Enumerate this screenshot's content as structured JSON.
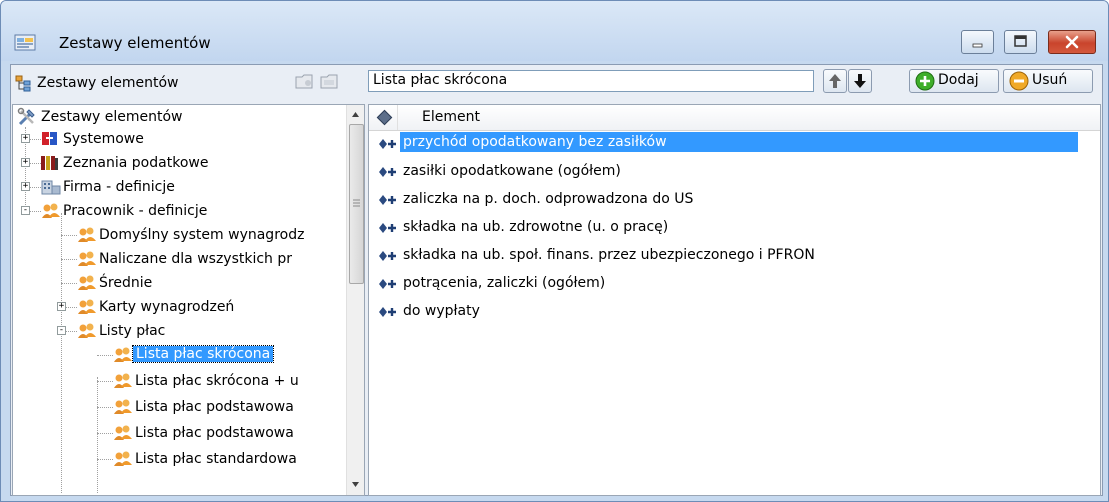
{
  "window": {
    "title": "Zestawy elementów",
    "controls": [
      "minimize",
      "maximize",
      "close"
    ]
  },
  "tree_toolbar": {
    "label": "Zestawy elementów",
    "buttons": [
      "new-folder-icon",
      "folder-icon"
    ]
  },
  "current_set": {
    "value": "Lista płac skrócona"
  },
  "actions": {
    "up_icon": "arrow-up-icon",
    "down_icon": "arrow-down-icon",
    "add_label": "Dodaj",
    "remove_label": "Usuń"
  },
  "tree": {
    "root": "Zestawy elementów",
    "items": [
      {
        "label": "Systemowe",
        "icon": "system-icon",
        "expander": "+"
      },
      {
        "label": "Zeznania podatkowe",
        "icon": "books-icon",
        "expander": "+"
      },
      {
        "label": "Firma - definicje",
        "icon": "building-icon",
        "expander": "+"
      },
      {
        "label": "Pracownik - definicje",
        "icon": "people-icon",
        "expander": "-"
      },
      {
        "label": "Domyślny system wynagrodz",
        "icon": "people-icon"
      },
      {
        "label": "Naliczane dla wszystkich pr",
        "icon": "people-icon"
      },
      {
        "label": "Średnie",
        "icon": "people-icon"
      },
      {
        "label": "Karty wynagrodzeń",
        "icon": "people-icon",
        "expander": "+"
      },
      {
        "label": "Listy płac",
        "icon": "people-icon",
        "expander": "-"
      },
      {
        "label": "Lista płac skrócona",
        "icon": "people-icon",
        "selected": true
      },
      {
        "label": "Lista płac skrócona + u",
        "icon": "people-icon"
      },
      {
        "label": "Lista płac podstawowa",
        "icon": "people-icon"
      },
      {
        "label": "Lista płac podstawowa",
        "icon": "people-icon"
      },
      {
        "label": "Lista płac standardowa",
        "icon": "people-icon"
      }
    ]
  },
  "list": {
    "column": "Element",
    "rows": [
      "przychód opodatkowany bez zasiłków",
      "zasiłki opodatkowane (ogółem)",
      "zaliczka na p. doch. odprowadzona do US",
      "składka na ub. zdrowotne (u. o pracę)",
      "składka na ub. społ. finans. przez ubezpieczonego i PFRON",
      "potrącenia, zaliczki (ogółem)",
      "do wypłaty"
    ],
    "selected_index": 0
  },
  "colors": {
    "selection": "#3399ff",
    "window_frame": "#c6d9ef",
    "close_button": "#c9442c"
  }
}
